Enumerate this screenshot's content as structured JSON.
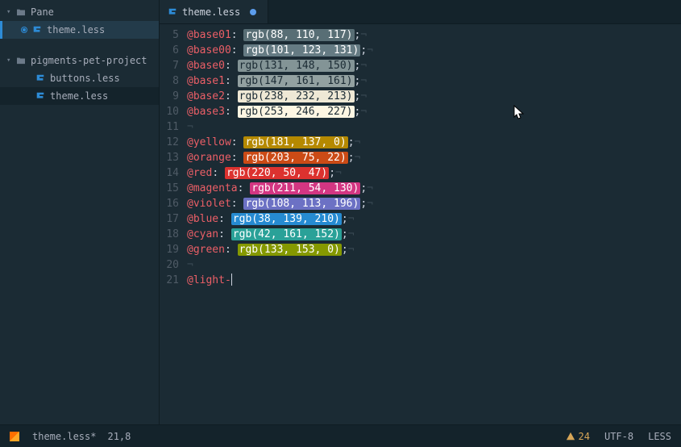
{
  "sidebar": {
    "pane_label": "Pane",
    "pane_file": "theme.less",
    "project_name": "pigments-pet-project",
    "files": [
      {
        "name": "buttons.less"
      },
      {
        "name": "theme.less"
      }
    ]
  },
  "tab": {
    "title": "theme.less",
    "dirty": true
  },
  "gutter_start": 5,
  "gutter_end": 21,
  "lines": [
    {
      "var": "@base01",
      "rgb_text": "rgb(88, 110, 117)",
      "bg": "#586e75",
      "fg": "#ffffff"
    },
    {
      "var": "@base00",
      "rgb_text": "rgb(101, 123, 131)",
      "bg": "#657b83",
      "fg": "#ffffff"
    },
    {
      "var": "@base0",
      "rgb_text": "rgb(131, 148, 150)",
      "bg": "#839496",
      "fg": "#1b2b34"
    },
    {
      "var": "@base1",
      "rgb_text": "rgb(147, 161, 161)",
      "bg": "#93a1a1",
      "fg": "#1b2b34"
    },
    {
      "var": "@base2",
      "rgb_text": "rgb(238, 232, 213)",
      "bg": "#eee8d5",
      "fg": "#1b2b34"
    },
    {
      "var": "@base3",
      "rgb_text": "rgb(253, 246, 227)",
      "bg": "#fdf6e3",
      "fg": "#1b2b34"
    },
    {
      "blank": true
    },
    {
      "var": "@yellow",
      "rgb_text": "rgb(181, 137, 0)",
      "bg": "#b58900",
      "fg": "#ffffff"
    },
    {
      "var": "@orange",
      "rgb_text": "rgb(203, 75, 22)",
      "bg": "#cb4b16",
      "fg": "#ffffff"
    },
    {
      "var": "@red",
      "rgb_text": "rgb(220, 50, 47)",
      "bg": "#dc322f",
      "fg": "#ffffff"
    },
    {
      "var": "@magenta",
      "rgb_text": "rgb(211, 54, 130)",
      "bg": "#d33682",
      "fg": "#ffffff"
    },
    {
      "var": "@violet",
      "rgb_text": "rgb(108, 113, 196)",
      "bg": "#6c71c4",
      "fg": "#ffffff"
    },
    {
      "var": "@blue",
      "rgb_text": "rgb(38, 139, 210)",
      "bg": "#268bd2",
      "fg": "#ffffff"
    },
    {
      "var": "@cyan",
      "rgb_text": "rgb(42, 161, 152)",
      "bg": "#2aa198",
      "fg": "#ffffff"
    },
    {
      "var": "@green",
      "rgb_text": "rgb(133, 153, 0)",
      "bg": "#859900",
      "fg": "#ffffff"
    },
    {
      "blank": true
    },
    {
      "partial": "@light-"
    }
  ],
  "status": {
    "filename": "theme.less*",
    "cursor_pos": "21,8",
    "warn_count": "24",
    "encoding": "UTF-8",
    "grammar": "LESS"
  }
}
